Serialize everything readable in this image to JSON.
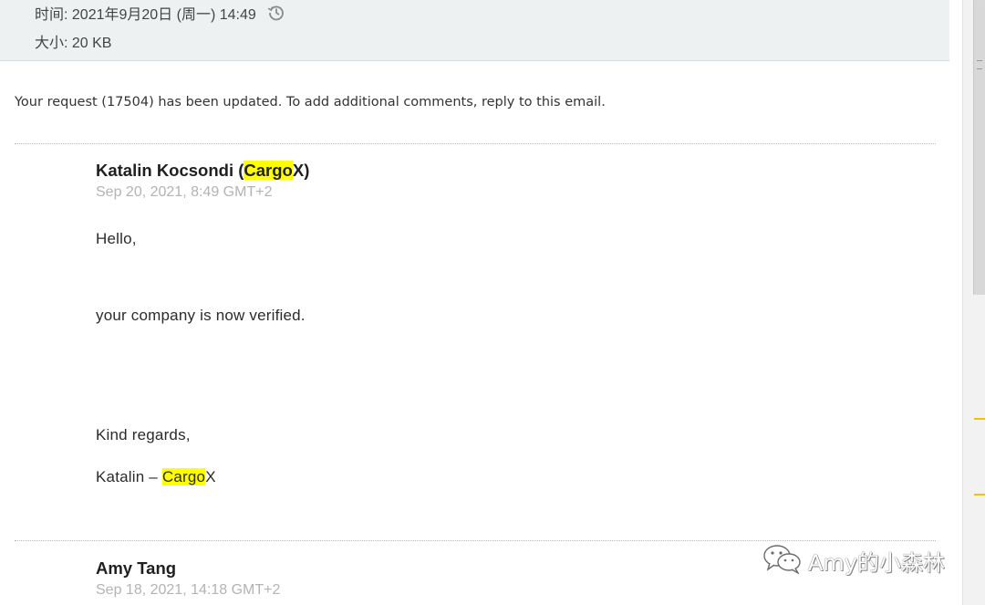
{
  "header": {
    "time_label": "时间: 2021年9月20日 (周一) 14:49",
    "size_label": "大小: 20 KB",
    "history_icon": "history-clock-icon"
  },
  "intro": "Your request (17504) has been updated. To add additional comments, reply to this email.",
  "comments": [
    {
      "author_name": "Katalin Kocsondi (",
      "author_hl": "Cargo",
      "author_tail": "X)",
      "timestamp": "Sep 20, 2021, 8:49 GMT+2",
      "greeting": "Hello,",
      "body": "your company is now verified.",
      "closing": "Kind regards,",
      "signature_name": "Katalin – ",
      "signature_hl": "Cargo",
      "signature_tail": "X"
    },
    {
      "author_name": "Amy Tang",
      "timestamp": "Sep 18, 2021, 14:18 GMT+2"
    }
  ],
  "watermark": {
    "icon": "wechat-icon",
    "text": "Amy的小森林"
  },
  "colors": {
    "highlight": "#ffff00",
    "header_bg": "#eef1f2",
    "timestamp": "#b3b3b3",
    "scroll_marker": "#f2c500"
  }
}
